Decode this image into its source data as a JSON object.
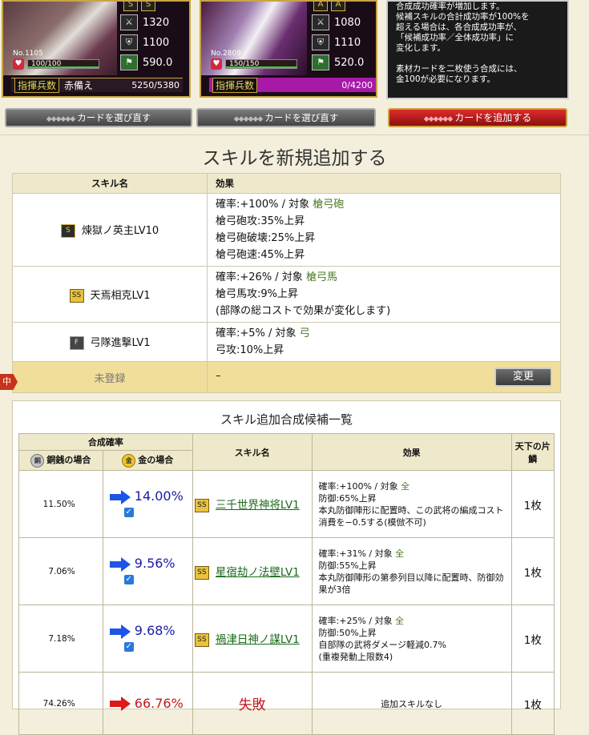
{
  "cards": [
    {
      "no": "No.1105",
      "stats": [
        "1320",
        "1100",
        "590.0"
      ],
      "hp": "100/100",
      "hp_fraction": 1.0,
      "command_label": "指揮兵数",
      "command_unit": "赤備え",
      "command_value": "5250/5380",
      "skill_marks": [
        "S",
        "S"
      ]
    },
    {
      "no": "No.2809",
      "stats": [
        "1080",
        "1110",
        "520.0"
      ],
      "hp": "150/150",
      "hp_fraction": 1.0,
      "command_label": "指揮兵数",
      "command_unit": "",
      "command_value": "0/4200",
      "skill_marks": [
        "A",
        "A"
      ]
    }
  ],
  "info_box": [
    "合成成功確率が増加します。",
    "候補スキルの合計成功率が100%を",
    "超える場合は、各合成成功率が、",
    "「候補成功率／全体成功率」に",
    "変化します。",
    "",
    "素材カードを二枚使う合成には、",
    "金100が必要になります。"
  ],
  "buttons": {
    "reselect1": "カードを選び直す",
    "reselect2": "カードを選び直す",
    "add_card": "カードを追加する"
  },
  "heading": "スキルを新規追加する",
  "skills_table": {
    "col_name": "スキル名",
    "col_effect": "効果",
    "rows": [
      {
        "rank": "S",
        "name": "煉獄ノ英主LV10",
        "lines": [
          {
            "text": "確率:+100%  /  対象 ",
            "target": "槍弓砲"
          },
          {
            "text": "槍弓砲攻:35%上昇"
          },
          {
            "text": "槍弓砲破壊:25%上昇"
          },
          {
            "text": "槍弓砲速:45%上昇"
          }
        ]
      },
      {
        "rank": "SS",
        "name": "天焉相克LV1",
        "lines": [
          {
            "text": "確率:+26%  /  対象 ",
            "target": "槍弓馬"
          },
          {
            "text": "槍弓馬攻:9%上昇"
          },
          {
            "text": "(部隊の総コストで効果が変化します)"
          }
        ]
      },
      {
        "rank": "F",
        "name": "弓隊進撃LV1",
        "lines": [
          {
            "text": "確率:+5%  /  対象 ",
            "target": "弓"
          },
          {
            "text": "弓攻:10%上昇"
          }
        ]
      }
    ],
    "unregistered": {
      "name": "未登録",
      "effect": "–",
      "button": "変更",
      "marker": "中"
    }
  },
  "candidates": {
    "title": "スキル追加合成候補一覧",
    "header_rate": "合成確率",
    "header_copper": "銅銭の場合",
    "header_gold": "金の場合",
    "header_name": "スキル名",
    "header_effect": "効果",
    "header_count": "天下の片鱗",
    "coin_copper": "銅",
    "coin_gold": "金",
    "rows": [
      {
        "copper": "11.50%",
        "gold": "14.00%",
        "rank": "SS",
        "name": "三千世界神将LV1",
        "effect": [
          {
            "text": "確率:+100%  /  対象 ",
            "target": "全"
          },
          {
            "text": "防御:65%上昇"
          },
          {
            "text": "本丸防御陣形に配置時、この武将の編成コスト消費を−0.5する(模倣不可)"
          }
        ],
        "count": "1枚",
        "arrow": "#1d55e6"
      },
      {
        "copper": "7.06%",
        "gold": "9.56%",
        "rank": "SS",
        "name": "星宿劫ノ法壁LV1",
        "effect": [
          {
            "text": "確率:+31%  /  対象 ",
            "target": "全"
          },
          {
            "text": "防御:55%上昇"
          },
          {
            "text": "本丸防御陣形の第参列目以降に配置時、防御効果が3倍"
          }
        ],
        "count": "1枚",
        "arrow": "#1d55e6"
      },
      {
        "copper": "7.18%",
        "gold": "9.68%",
        "rank": "SS",
        "name": "禍津日神ノ謀LV1",
        "effect": [
          {
            "text": "確率:+25%  /  対象 ",
            "target": "全"
          },
          {
            "text": "防御:50%上昇"
          },
          {
            "text": "自部隊の武将ダメージ軽減0.7%"
          },
          {
            "text": "(重複発動上限数4)"
          }
        ],
        "count": "1枚",
        "arrow": "#1d55e6"
      }
    ],
    "fail_row": {
      "copper": "74.26%",
      "gold": "66.76%",
      "label": "失敗",
      "effect": "追加スキルなし",
      "count": "1枚",
      "arrow": "#e01818"
    }
  }
}
